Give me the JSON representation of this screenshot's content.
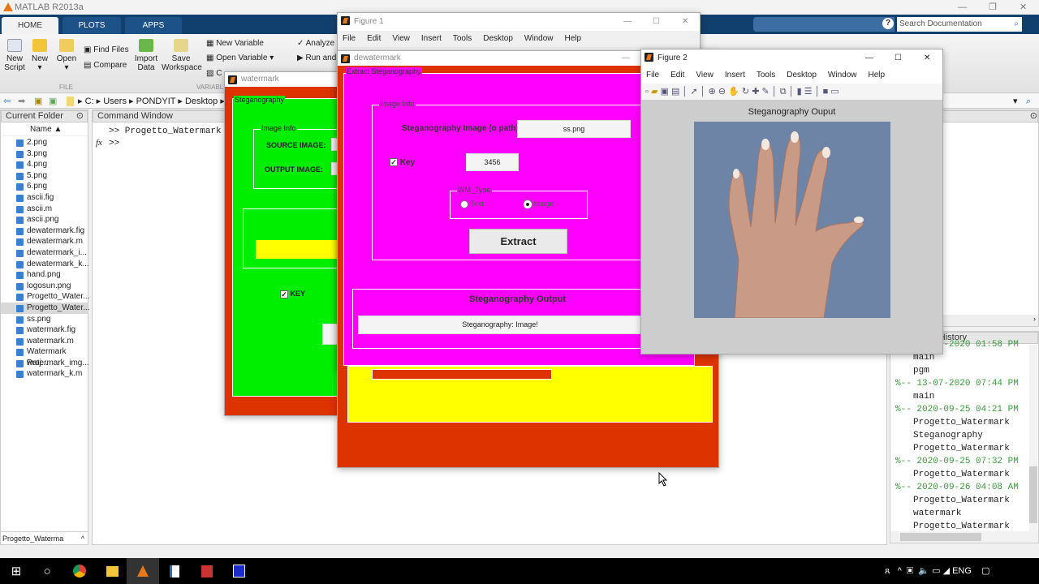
{
  "app": {
    "title": "MATLAB R2013a"
  },
  "tabs": [
    "HOME",
    "PLOTS",
    "APPS"
  ],
  "search": {
    "placeholder": "Search Documentation"
  },
  "ribbon": {
    "new_script": [
      "New",
      "Script"
    ],
    "new": "New",
    "open": "Open",
    "find_files": "Find Files",
    "compare": "Compare",
    "import_data": [
      "Import",
      "Data"
    ],
    "save_workspace": [
      "Save",
      "Workspace"
    ],
    "new_variable": "New Variable",
    "open_variable": "Open Variable",
    "clear": "C",
    "analyze": "Analyze",
    "run_and": "Run and",
    "group_file": "FILE",
    "group_variable": "VARIABLE"
  },
  "address": [
    "C:",
    "Users",
    "PONDYIT",
    "Desktop"
  ],
  "current_folder": {
    "title": "Current Folder",
    "name_header": "Name ▲",
    "files": [
      "2.png",
      "3.png",
      "4.png",
      "5.png",
      "6.png",
      "ascii.fig",
      "ascii.m",
      "ascii.png",
      "dewatermark.fig",
      "dewatermark.m",
      "dewatermark_i...",
      "dewatermark_k...",
      "hand.png",
      "logosun.png",
      "Progetto_Water...",
      "Progetto_Water...",
      "ss.png",
      "watermark.fig",
      "watermark.m",
      "Watermark Proj...",
      "watermark_img...",
      "watermark_k.m"
    ],
    "selected_index": 15,
    "footer": "Progetto_Waterma"
  },
  "command_window": {
    "title": "Command Window",
    "lines": [
      ">> Progetto_Watermark",
      ">>"
    ],
    "fx": "fx"
  },
  "history": {
    "title": "Command History",
    "lines": [
      {
        "t": "%-- 13-07-2020 01:58 PM",
        "g": true
      },
      {
        "t": "main"
      },
      {
        "t": "pgm"
      },
      {
        "t": "%-- 13-07-2020 07:44 PM",
        "g": true
      },
      {
        "t": "main"
      },
      {
        "t": "%-- 2020-09-25 04:21 PM",
        "g": true
      },
      {
        "t": "Progetto_Watermark"
      },
      {
        "t": "Steganography"
      },
      {
        "t": "Progetto_Watermark"
      },
      {
        "t": "%-- 2020-09-25 07:32 PM",
        "g": true
      },
      {
        "t": "Progetto_Watermark"
      },
      {
        "t": "%-- 2020-09-26 04:08 AM",
        "g": true
      },
      {
        "t": "Progetto_Watermark"
      },
      {
        "t": "watermark"
      },
      {
        "t": "Progetto_Watermark"
      }
    ]
  },
  "watermark_win": {
    "title": "watermark",
    "panel": "Steganography",
    "image_info": "Image Info",
    "source": "SOURCE IMAGE:",
    "output": "OUTPUT IMAGE:",
    "key": "KEY"
  },
  "figure1": {
    "title": "Figure 1",
    "menu": [
      "File",
      "Edit",
      "View",
      "Insert",
      "Tools",
      "Desktop",
      "Window",
      "Help"
    ]
  },
  "dewatermark": {
    "title": "dewatermark",
    "panel": "Extract Steganography",
    "image_info": "Image Info",
    "steg_label": "Steganography Image (o path):",
    "steg_value": "ss.png",
    "key_label": "Key",
    "key_value": "3456",
    "key_checked": true,
    "wm_type": "WM_Type",
    "radio_text": "Text",
    "radio_image": "Image",
    "selected": "Image",
    "extract": "Extract",
    "output_title": "Steganography Output",
    "output_value": "Steganography: Image!"
  },
  "figure2": {
    "title": "Figure 2",
    "menu": [
      "File",
      "Edit",
      "View",
      "Insert",
      "Tools",
      "Desktop",
      "Window",
      "Help"
    ],
    "axes_title": "Steganography Ouput"
  },
  "tray": {
    "lang": "ENG"
  },
  "colors": {
    "ribbon_blue": "#12406e",
    "red": "#dd3300",
    "green": "#00ee00",
    "magenta": "#ff00ff",
    "yellow": "#ffff00"
  }
}
